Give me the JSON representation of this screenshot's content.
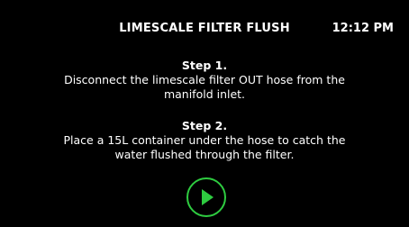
{
  "header": {
    "title": "LIMESCALE FILTER FLUSH",
    "time": "12:12  PM"
  },
  "steps": [
    {
      "title": "Step 1.",
      "text": "Disconnect the limescale filter OUT hose from the manifold inlet."
    },
    {
      "title": "Step 2.",
      "text": "Place a 15L container under the hose to catch the water flushed through the filter."
    }
  ],
  "controls": {
    "play_icon": "play-icon",
    "accent_color": "#2ecc40"
  }
}
